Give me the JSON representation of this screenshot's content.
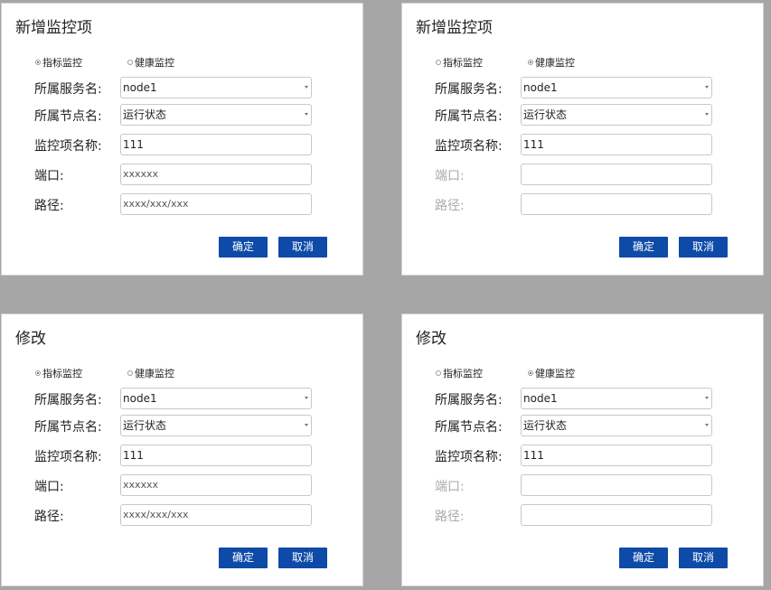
{
  "panels": [
    {
      "title": "新增监控项",
      "radio_metric": "指标监控",
      "radio_health": "健康监控",
      "fields": {
        "service_label": "所属服务名:",
        "service_value": "node1",
        "node_label": "所属节点名:",
        "node_value": "运行状态",
        "name_label": "监控项名称:",
        "name_value": "111",
        "port_label": "端口:",
        "port_value": "xxxxxx",
        "path_label": "路径:",
        "path_value": "xxxx/xxx/xxx"
      },
      "confirm": "确定",
      "cancel": "取消"
    },
    {
      "title": "新增监控项",
      "radio_metric": "指标监控",
      "radio_health": "健康监控",
      "fields": {
        "service_label": "所属服务名:",
        "service_value": "node1",
        "node_label": "所属节点名:",
        "node_value": "运行状态",
        "name_label": "监控项名称:",
        "name_value": "111",
        "port_label": "端口:",
        "port_value": "",
        "path_label": "路径:",
        "path_value": ""
      },
      "confirm": "确定",
      "cancel": "取消"
    },
    {
      "title": "修改",
      "radio_metric": "指标监控",
      "radio_health": "健康监控",
      "fields": {
        "service_label": "所属服务名:",
        "service_value": "node1",
        "node_label": "所属节点名:",
        "node_value": "运行状态",
        "name_label": "监控项名称:",
        "name_value": "111",
        "port_label": "端口:",
        "port_value": "xxxxxx",
        "path_label": "路径:",
        "path_value": "xxxx/xxx/xxx"
      },
      "confirm": "确定",
      "cancel": "取消"
    },
    {
      "title": "修改",
      "radio_metric": "指标监控",
      "radio_health": "健康监控",
      "fields": {
        "service_label": "所属服务名:",
        "service_value": "node1",
        "node_label": "所属节点名:",
        "node_value": "运行状态",
        "name_label": "监控项名称:",
        "name_value": "111",
        "port_label": "端口:",
        "port_value": "",
        "path_label": "路径:",
        "path_value": ""
      },
      "confirm": "确定",
      "cancel": "取消"
    }
  ],
  "colors": {
    "background": "#a6a6a6",
    "button": "#0e4ba8",
    "disabled_label": "#aaaaaa"
  }
}
